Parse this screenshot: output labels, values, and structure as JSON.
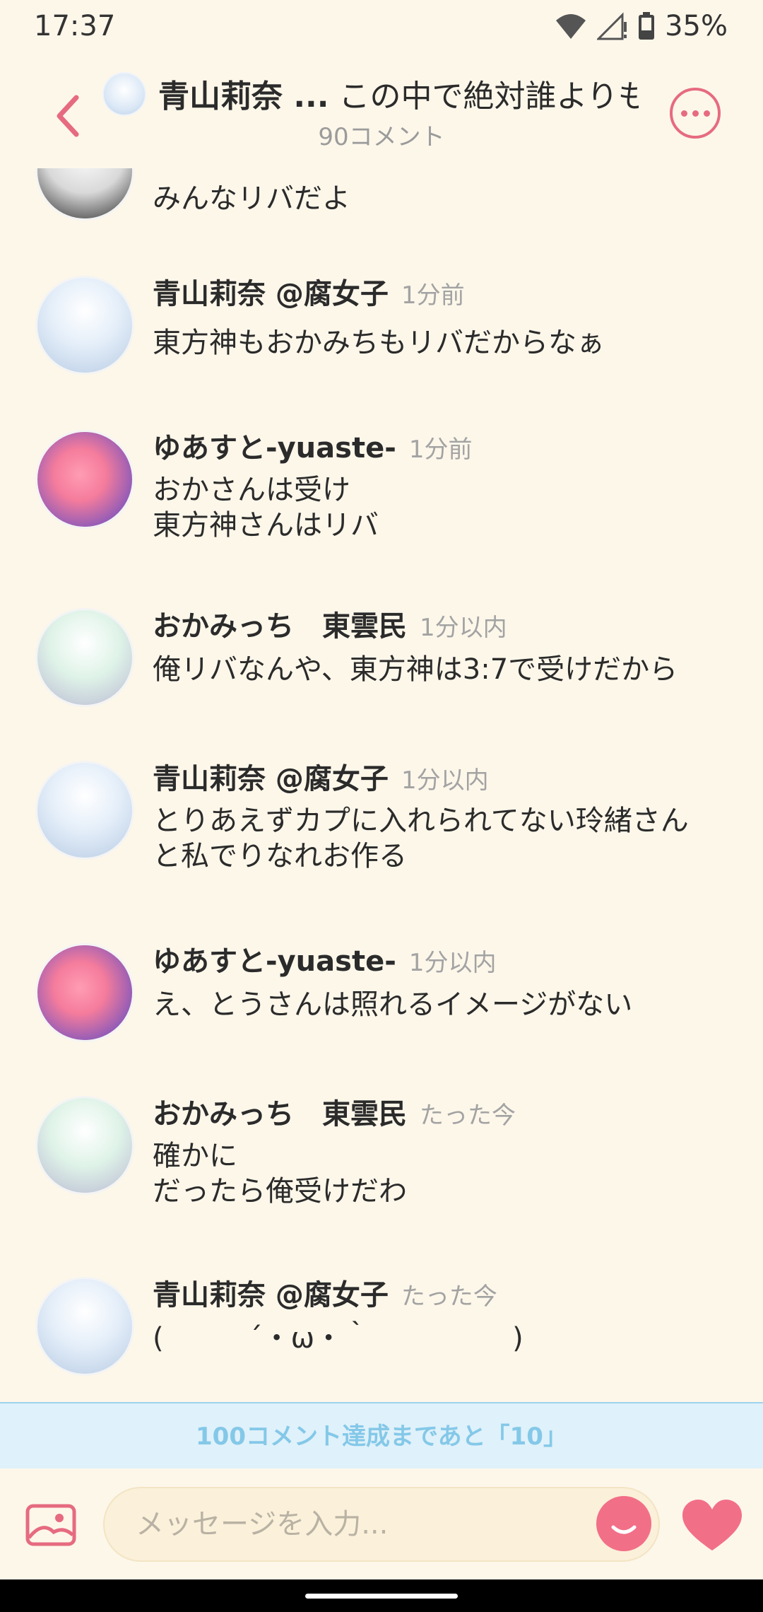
{
  "status": {
    "time": "17:37",
    "battery": "35%"
  },
  "header": {
    "author": "青山莉奈 ...",
    "title": "この中で絶対誰よりも...",
    "comment_count": "90コメント"
  },
  "comments": [
    {
      "name": "",
      "time": "",
      "lines": [
        "みんなリバだよ"
      ],
      "avatar": "gray"
    },
    {
      "name": "青山莉奈 @腐女子",
      "time": "1分前",
      "lines": [
        "東方神もおかみちもリバだからなぁ"
      ],
      "avatar": "blue"
    },
    {
      "name": "ゆあすと-yuaste-",
      "time": "1分前",
      "lines": [
        "おかさんは受け",
        "東方神さんはリバ"
      ],
      "avatar": "pink"
    },
    {
      "name": "おかみっち　東雲民",
      "time": "1分以内",
      "lines": [
        "俺リバなんや、東方神は3:7で受けだから"
      ],
      "avatar": "green"
    },
    {
      "name": "青山莉奈 @腐女子",
      "time": "1分以内",
      "lines": [
        "とりあえずカプに入れられてない玲緒さん",
        "と私でりなれお作る"
      ],
      "avatar": "blue"
    },
    {
      "name": "ゆあすと-yuaste-",
      "time": "1分以内",
      "lines": [
        "え、とうさんは照れるイメージがない"
      ],
      "avatar": "pink"
    },
    {
      "name": "おかみっち　東雲民",
      "time": "たった今",
      "lines": [
        "確かに",
        "だったら俺受けだわ"
      ],
      "avatar": "green"
    },
    {
      "name": "青山莉奈 @腐女子",
      "time": "たった今",
      "lines": [
        "(　　　´・ω・｀　　　　　)"
      ],
      "avatar": "blue"
    }
  ],
  "milestone": "100コメント達成まであと「10」",
  "input": {
    "placeholder": "メッセージを入力..."
  },
  "colors": {
    "accent": "#e66b80",
    "background": "#fdf7ea",
    "milestone_bg": "#dff1fa",
    "milestone_text": "#84c8e8"
  },
  "icons": [
    "back-icon",
    "more-icon",
    "image-icon",
    "emoji-icon",
    "heart-icon",
    "wifi-icon",
    "signal-icon",
    "battery-icon"
  ]
}
